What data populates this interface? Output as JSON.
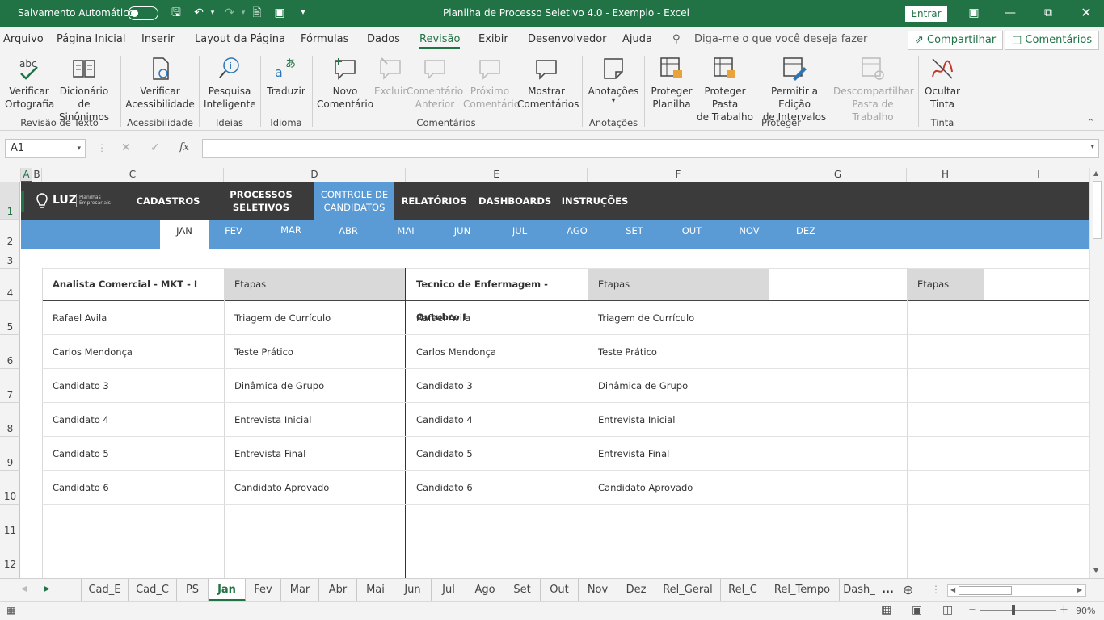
{
  "titlebar": {
    "autosave_label": "Salvamento Automático",
    "title": "Planilha de Processo Seletivo 4.0 - Exemplo  -  Excel",
    "signin_label": "Entrar"
  },
  "menu": {
    "tabs": [
      "Arquivo",
      "Página Inicial",
      "Inserir",
      "Layout da Página",
      "Fórmulas",
      "Dados",
      "Revisão",
      "Exibir",
      "Desenvolvedor",
      "Ajuda"
    ],
    "active": "Revisão",
    "tellme": "Diga-me o que você deseja fazer",
    "share_label": "Compartilhar",
    "comments_label": "Comentários"
  },
  "ribbon": {
    "buttons": {
      "spell": "Verificar\nOrtografia",
      "thesaurus": "Dicionário de\nSinônimos",
      "accessibility": "Verificar\nAcessibilidade",
      "smartlookup": "Pesquisa\nInteligente",
      "translate": "Traduzir",
      "newcomment": "Novo\nComentário",
      "delete": "Excluir",
      "prevcomment": "Comentário\nAnterior",
      "nextcomment": "Próximo\nComentário",
      "showcomments": "Mostrar\nComentários",
      "notes": "Anotações",
      "protectsheet": "Proteger\nPlanilha",
      "protectbook": "Proteger Pasta\nde Trabalho",
      "allowranges": "Permitir a Edição\nde Intervalos",
      "unshare": "Descompartilhar\nPasta de Trabalho",
      "hideink": "Ocultar\nTinta"
    },
    "groups": {
      "proofing": "Revisão de Texto",
      "accessibility": "Acessibilidade",
      "insights": "Ideias",
      "language": "Idioma",
      "comments": "Comentários",
      "notes": "Anotações",
      "protect": "Proteger",
      "ink": "Tinta"
    }
  },
  "formulabar": {
    "namebox": "A1",
    "fx": "fx"
  },
  "columns": [
    "A",
    "B",
    "C",
    "D",
    "E",
    "F",
    "G",
    "H",
    "I"
  ],
  "rows": [
    "1",
    "2",
    "3",
    "4",
    "5",
    "6",
    "7",
    "8",
    "9",
    "10",
    "11",
    "12"
  ],
  "sheet": {
    "logo": "LUZ",
    "logo_sub": "Planilhas\nEmpresariais",
    "nav": {
      "cadastros": "CADASTROS",
      "processos": "PROCESSOS\nSELETIVOS",
      "controle": "CONTROLE DE\nCANDIDATOS",
      "relatorios": "RELATÓRIOS",
      "dashboards": "DASHBOARDS",
      "instrucoes": "INSTRUÇÕES"
    },
    "months": [
      "JAN",
      "FEV",
      "MAR",
      "ABR",
      "MAI",
      "JUN",
      "JUL",
      "AGO",
      "SET",
      "OUT",
      "NOV",
      "DEZ"
    ],
    "active_month": "JAN",
    "block1": {
      "title": "Analista Comercial - MKT - I",
      "stage_header": "Etapas",
      "candidates": [
        "Rafael Avila",
        "Carlos Mendonça",
        "Candidato 3",
        "Candidato 4",
        "Candidato 5",
        "Candidato 6"
      ],
      "stages": [
        "Triagem de Currículo",
        "Teste Prático",
        "Dinâmica de Grupo",
        "Entrevista Inicial",
        "Entrevista Final",
        "Candidato Aprovado"
      ]
    },
    "block2": {
      "title": "Tecnico de Enfermagem - Outubro I",
      "stage_header": "Etapas",
      "candidates": [
        "Rafael Avila",
        "Carlos Mendonça",
        "Candidato 3",
        "Candidato 4",
        "Candidato 5",
        "Candidato 6"
      ],
      "stages": [
        "Triagem de Currículo",
        "Teste Prático",
        "Dinâmica de Grupo",
        "Entrevista Inicial",
        "Entrevista Final",
        "Candidato Aprovado"
      ]
    },
    "block3": {
      "stage_header": "Etapas"
    }
  },
  "sheet_tabs": [
    "Cad_E",
    "Cad_C",
    "PS",
    "Jan",
    "Fev",
    "Mar",
    "Abr",
    "Mai",
    "Jun",
    "Jul",
    "Ago",
    "Set",
    "Out",
    "Nov",
    "Dez",
    "Rel_Geral",
    "Rel_C",
    "Rel_Tempo",
    "Dash_"
  ],
  "active_sheet": "Jan",
  "tabs_more": "...",
  "status": {
    "zoom": "90%"
  },
  "colors": {
    "excel_green": "#217346",
    "nav_dark": "#3b3b3b",
    "month_blue": "#5b9bd5"
  }
}
